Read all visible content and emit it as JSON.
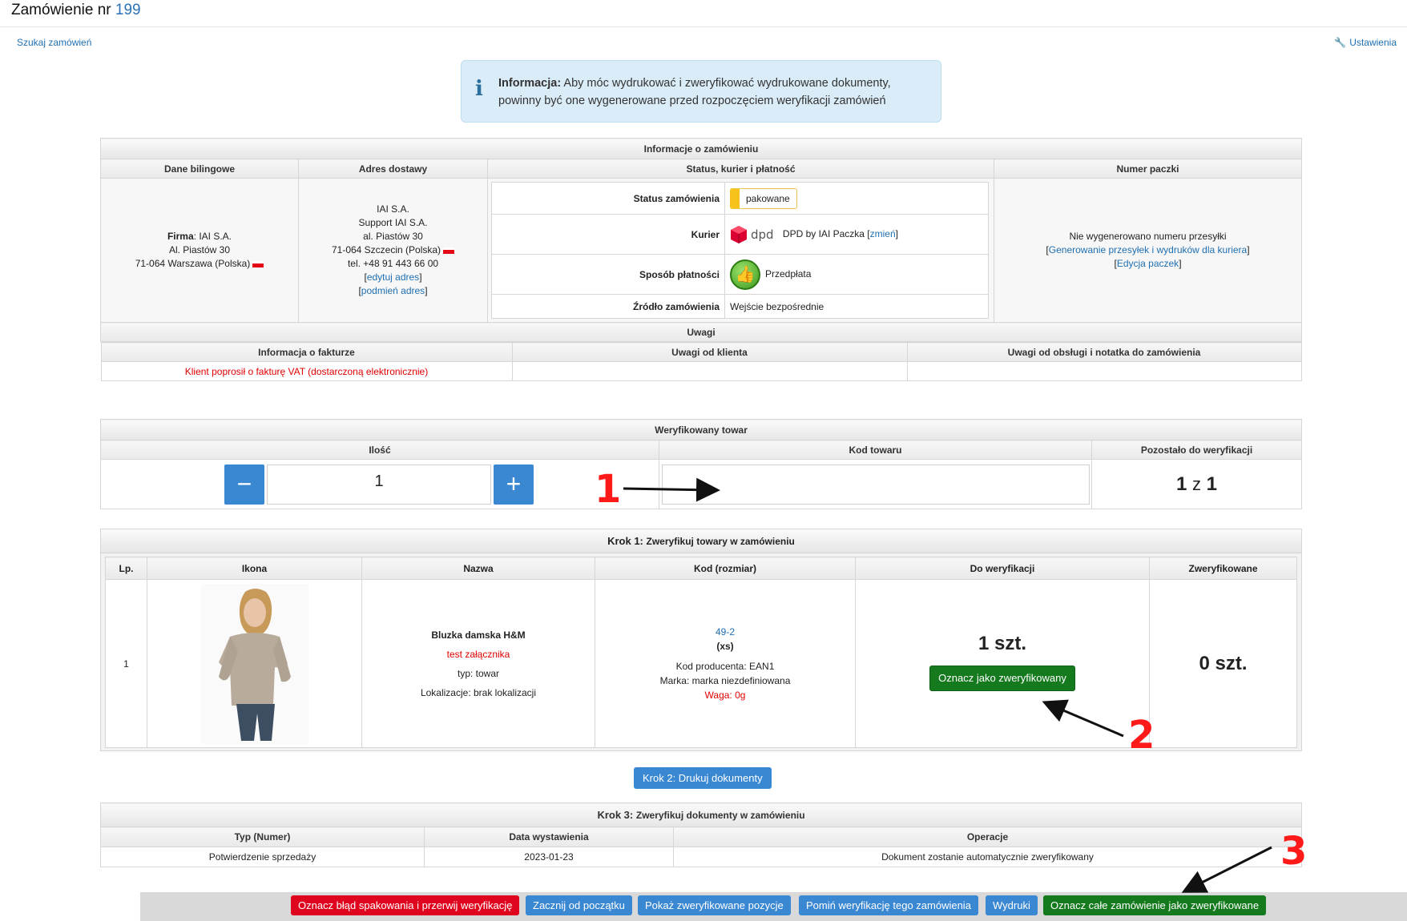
{
  "header": {
    "title_prefix": "Zamówienie nr",
    "order_number": "199",
    "search_link": "Szukaj zamówień",
    "settings_link": "Ustawienia"
  },
  "info_box": {
    "label": "Informacja:",
    "text": "Aby móc wydrukować i zweryfikować wydrukowane dokumenty, powinny być one wygenerowane przed rozpoczęciem weryfikacji zamówień"
  },
  "order_info": {
    "title": "Informacje o zamówieniu",
    "columns": [
      "Dane bilingowe",
      "Adres dostawy",
      "Status, kurier i płatność",
      "Numer paczki"
    ],
    "billing": {
      "firma_label": "Firma",
      "firma_value": ": IAI S.A.",
      "street": "Al. Piastów 30",
      "city": "71-064 Warszawa (Polska)"
    },
    "delivery": {
      "line1": "IAI S.A.",
      "line2": "Support IAI S.A.",
      "line3": "al. Piastów 30",
      "line4": "71-064 Szczecin (Polska)",
      "phone": "tel. +48 91 443 66 00",
      "edit_link": "edytuj adres",
      "replace_link": "podmień adres"
    },
    "status": {
      "status_label": "Status zamówienia",
      "status_value": "pakowane",
      "courier_label": "Kurier",
      "courier_logo_text": "dpd",
      "courier_value": "DPD by IAI Paczka",
      "courier_change": "zmień",
      "payment_label": "Sposób płatności",
      "payment_value": "Przedpłata",
      "source_label": "Źródło zamówienia",
      "source_value": "Wejście bezpośrednie"
    },
    "package": {
      "none_text": "Nie wygenerowano numeru przesyłki",
      "generate_link": "Generowanie przesyłek i wydruków dla kuriera",
      "edit_link": "Edycja paczek"
    },
    "remarks_title": "Uwagi",
    "remarks_columns": [
      "Informacja o fakturze",
      "Uwagi od klienta",
      "Uwagi od obsługi i notatka do zamówienia"
    ],
    "invoice_note": "Klient poprosił o fakturę VAT (dostarczoną elektronicznie)"
  },
  "verified_goods": {
    "title": "Weryfikowany towar",
    "columns": [
      "Ilość",
      "Kod towaru",
      "Pozostało do weryfikacji"
    ],
    "quantity": "1",
    "minus": "−",
    "plus": "+",
    "code_value": "",
    "remaining_left": "1",
    "remaining_sep": "z",
    "remaining_right": "1"
  },
  "step1": {
    "title_prefix": "Krok 1:",
    "title_rest": "Zweryfikuj towary w zamówieniu",
    "columns": [
      "Lp.",
      "Ikona",
      "Nazwa",
      "Kod (rozmiar)",
      "Do weryfikacji",
      "Zweryfikowane"
    ],
    "row": {
      "lp": "1",
      "name": "Bluzka damska H&M",
      "attachment": "test załącznika",
      "type": "typ: towar",
      "location": "Lokalizacje: brak lokalizacji",
      "code_link": "49-2",
      "size": "(xs)",
      "producer_code": "Kod producenta: EAN1",
      "brand": "Marka: marka niezdefiniowana",
      "weight": "Waga: 0g",
      "to_verify": "1 szt.",
      "mark_button": "Oznacz jako zweryfikowany",
      "verified": "0 szt."
    }
  },
  "step2_button": "Krok 2: Drukuj dokumenty",
  "step3": {
    "title_prefix": "Krok 3:",
    "title_rest": "Zweryfikuj dokumenty w zamówieniu",
    "columns": [
      "Typ (Numer)",
      "Data wystawienia",
      "Operacje"
    ],
    "row": {
      "type": "Potwierdzenie sprzedaży",
      "date": "2023-01-23",
      "operation": "Dokument zostanie automatycznie zweryfikowany"
    }
  },
  "bottom_bar": {
    "error_btn": "Oznacz błąd spakowania i przerwij weryfikację",
    "restart_btn": "Zacznij od początku",
    "show_btn": "Pokaż zweryfikowane pozycje",
    "skip_btn": "Pomiń weryfikację tego zamówienia",
    "prints_btn": "Wydruki",
    "mark_all_btn": "Oznacz całe zamówienie jako zweryfikowane"
  },
  "annotations": [
    "1",
    "2",
    "3"
  ],
  "colors": {
    "accent_blue": "#3a87d2",
    "green": "#157a1e",
    "red": "#e0051f",
    "annotation_red": "#ff1a1a"
  }
}
